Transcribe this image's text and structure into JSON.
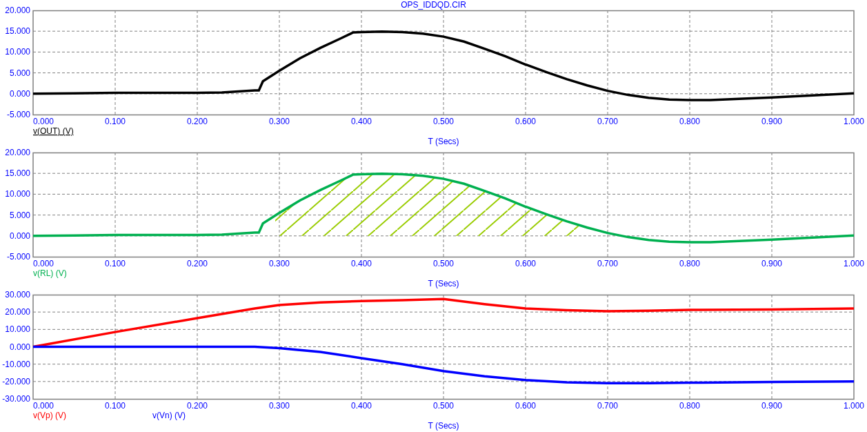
{
  "title": "OPS_IDDQD.CIR",
  "plots": [
    {
      "chart_data": {
        "type": "line",
        "xlabel": "T (Secs)",
        "xlim": [
          0,
          1
        ],
        "ylim": [
          -5,
          20
        ],
        "xticks": [
          {
            "value": 0,
            "label": "0.000"
          },
          {
            "value": 0.1,
            "label": "0.100"
          },
          {
            "value": 0.2,
            "label": "0.200"
          },
          {
            "value": 0.3,
            "label": "0.300"
          },
          {
            "value": 0.4,
            "label": "0.400"
          },
          {
            "value": 0.5,
            "label": "0.500"
          },
          {
            "value": 0.6,
            "label": "0.600"
          },
          {
            "value": 0.7,
            "label": "0.700"
          },
          {
            "value": 0.8,
            "label": "0.800"
          },
          {
            "value": 0.9,
            "label": "0.900"
          },
          {
            "value": 1,
            "label": "1.000"
          }
        ],
        "yticks": [
          {
            "value": 20,
            "label": "20.000"
          },
          {
            "value": 15,
            "label": "15.000"
          },
          {
            "value": 10,
            "label": "10.000"
          },
          {
            "value": 5,
            "label": "5.000"
          },
          {
            "value": 0,
            "label": "0.000"
          },
          {
            "value": -5,
            "label": "-5.000"
          }
        ],
        "x": [
          0,
          0.05,
          0.1,
          0.2,
          0.23,
          0.27,
          0.275,
          0.28,
          0.3,
          0.325,
          0.35,
          0.375,
          0.39,
          0.4,
          0.425,
          0.45,
          0.475,
          0.5,
          0.525,
          0.55,
          0.575,
          0.6,
          0.625,
          0.65,
          0.675,
          0.7,
          0.725,
          0.75,
          0.775,
          0.8,
          0.825,
          0.85,
          0.9,
          0.95,
          1
        ],
        "series": [
          {
            "name": "v(OUT) (V)",
            "color": "#000000",
            "values": [
              0,
              0.1,
              0.2,
              0.2,
              0.3,
              0.8,
              0.8,
              3,
              5.5,
              8.5,
              11,
              13.3,
              14.7,
              14.8,
              14.9,
              14.8,
              14.4,
              13.7,
              12.5,
              10.8,
              9,
              7,
              5.2,
              3.5,
              2,
              0.7,
              -0.3,
              -1,
              -1.4,
              -1.5,
              -1.5,
              -1.3,
              -0.9,
              -0.4,
              0.1
            ]
          }
        ],
        "grid": true
      },
      "legend": [
        {
          "selected": true
        }
      ]
    },
    {
      "chart_data": {
        "type": "line",
        "xlabel": "T (Secs)",
        "xlim": [
          0,
          1
        ],
        "ylim": [
          -5,
          20
        ],
        "xticks": [
          {
            "value": 0,
            "label": "0.000"
          },
          {
            "value": 0.1,
            "label": "0.100"
          },
          {
            "value": 0.2,
            "label": "0.200"
          },
          {
            "value": 0.3,
            "label": "0.300"
          },
          {
            "value": 0.4,
            "label": "0.400"
          },
          {
            "value": 0.5,
            "label": "0.500"
          },
          {
            "value": 0.6,
            "label": "0.600"
          },
          {
            "value": 0.7,
            "label": "0.700"
          },
          {
            "value": 0.8,
            "label": "0.800"
          },
          {
            "value": 0.9,
            "label": "0.900"
          },
          {
            "value": 1,
            "label": "1.000"
          }
        ],
        "yticks": [
          {
            "value": 20,
            "label": "20.000"
          },
          {
            "value": 15,
            "label": "15.000"
          },
          {
            "value": 10,
            "label": "10.000"
          },
          {
            "value": 5,
            "label": "5.000"
          },
          {
            "value": 0,
            "label": "0.000"
          },
          {
            "value": -5,
            "label": "-5.000"
          }
        ],
        "x": [
          0,
          0.05,
          0.1,
          0.2,
          0.23,
          0.27,
          0.275,
          0.28,
          0.3,
          0.325,
          0.35,
          0.375,
          0.39,
          0.4,
          0.425,
          0.45,
          0.475,
          0.5,
          0.525,
          0.55,
          0.575,
          0.6,
          0.625,
          0.65,
          0.675,
          0.7,
          0.725,
          0.75,
          0.775,
          0.8,
          0.825,
          0.85,
          0.9,
          0.95,
          1
        ],
        "series": [
          {
            "name": "v(RL) (V)",
            "color": "#00b050",
            "values": [
              0,
              0.1,
              0.2,
              0.2,
              0.3,
              0.8,
              0.8,
              3,
              5.5,
              8.5,
              11,
              13.3,
              14.7,
              14.8,
              14.9,
              14.8,
              14.4,
              13.7,
              12.5,
              10.8,
              9,
              7,
              5.2,
              3.5,
              2,
              0.7,
              -0.3,
              -1,
              -1.4,
              -1.5,
              -1.5,
              -1.3,
              -0.9,
              -0.4,
              0.1
            ]
          }
        ],
        "grid": true,
        "bands": [
          {
            "axis": "x",
            "from": 0.295,
            "to": 0.665,
            "color": "#99cc00"
          }
        ]
      },
      "legend": [
        {
          "selected": false
        }
      ]
    },
    {
      "chart_data": {
        "type": "line",
        "xlabel": "T (Secs)",
        "xlim": [
          0,
          1
        ],
        "ylim": [
          -30,
          30
        ],
        "xticks": [
          {
            "value": 0,
            "label": "0.000"
          },
          {
            "value": 0.1,
            "label": "0.100"
          },
          {
            "value": 0.2,
            "label": "0.200"
          },
          {
            "value": 0.3,
            "label": "0.300"
          },
          {
            "value": 0.4,
            "label": "0.400"
          },
          {
            "value": 0.5,
            "label": "0.500"
          },
          {
            "value": 0.6,
            "label": "0.600"
          },
          {
            "value": 0.7,
            "label": "0.700"
          },
          {
            "value": 0.8,
            "label": "0.800"
          },
          {
            "value": 0.9,
            "label": "0.900"
          },
          {
            "value": 1,
            "label": "1.000"
          }
        ],
        "yticks": [
          {
            "value": 30,
            "label": "30.000"
          },
          {
            "value": 20,
            "label": "20.000"
          },
          {
            "value": 10,
            "label": "10.000"
          },
          {
            "value": 0,
            "label": "0.000"
          },
          {
            "value": -10,
            "label": "-10.000"
          },
          {
            "value": -20,
            "label": "-20.000"
          },
          {
            "value": -30,
            "label": "-30.000"
          }
        ],
        "x": [
          0,
          0.1,
          0.2,
          0.25,
          0.27,
          0.3,
          0.35,
          0.4,
          0.45,
          0.5,
          0.55,
          0.6,
          0.65,
          0.7,
          0.75,
          0.8,
          0.9,
          1
        ],
        "series": [
          {
            "name": "v(Vp) (V)",
            "color": "#ff0000",
            "values": [
              0,
              8.5,
              16.5,
              20.5,
              22,
              24,
              25.5,
              26.3,
              26.8,
              27.5,
              24.5,
              22,
              21,
              20.5,
              20.8,
              21.2,
              21.5,
              22
            ]
          },
          {
            "name": "v(Vn) (V)",
            "color": "#0000ff",
            "values": [
              0,
              0,
              0,
              0,
              0,
              -0.8,
              -3,
              -6.5,
              -10,
              -14,
              -17,
              -19.2,
              -20.5,
              -21,
              -21,
              -20.7,
              -20.3,
              -20
            ]
          }
        ],
        "grid": true
      },
      "legend": [
        {
          "selected": false
        },
        {
          "selected": false
        }
      ]
    }
  ]
}
